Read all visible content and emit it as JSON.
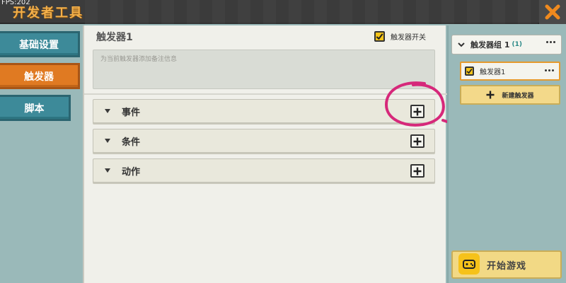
{
  "window": {
    "fps_label": "FPS:202",
    "title": "开发者工具"
  },
  "nav": {
    "items": [
      {
        "label": "基础设置"
      },
      {
        "label": "触发器"
      },
      {
        "label": "脚本"
      }
    ],
    "active_index": 1
  },
  "main": {
    "title": "触发器1",
    "switch_label": "触发器开关",
    "switch_checked": true,
    "note_placeholder": "为当前触发器添加备注信息",
    "sections": [
      {
        "label": "事件"
      },
      {
        "label": "条件"
      },
      {
        "label": "动作"
      }
    ]
  },
  "right": {
    "group_label": "触发器组 1",
    "group_count": "(1)",
    "trigger_item_label": "触发器1",
    "new_trigger_label": "新建触发器",
    "bottom_button_label": "开始游戏"
  },
  "colors": {
    "accent_orange": "#e07a22",
    "nav_teal": "#3d8a99",
    "checkbox_yellow": "#f5c419",
    "annotation_magenta": "#d6287a"
  }
}
